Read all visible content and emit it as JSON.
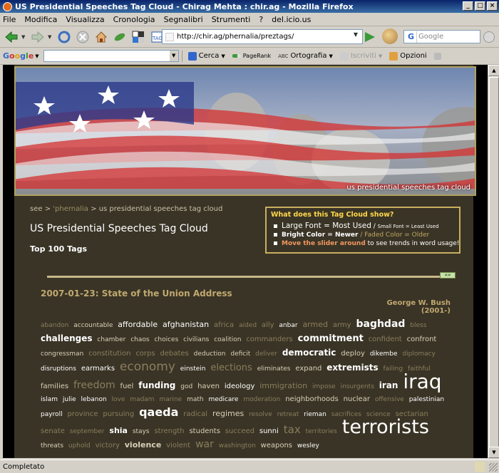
{
  "window": {
    "title": "US Presidential Speeches Tag Cloud - Chirag Mehta : chir.ag - Mozilla Firefox",
    "controls": [
      "_",
      "□",
      "×"
    ]
  },
  "menu": [
    {
      "label": "File"
    },
    {
      "label": "Modifica"
    },
    {
      "label": "Visualizza"
    },
    {
      "label": "Cronologia"
    },
    {
      "label": "Segnalibri"
    },
    {
      "label": "Strumenti"
    },
    {
      "label": "?"
    },
    {
      "label": "del.icio.us"
    }
  ],
  "nav": {
    "url": "http://chir.ag/phernalia/preztags/",
    "search_placeholder": "Google",
    "search_engine_glyph": "G"
  },
  "gtoolbar": {
    "logo": [
      "G",
      "o",
      "o",
      "g",
      "l",
      "e"
    ],
    "cerca": "Cerca",
    "pagerank": "PageRank",
    "ortografia": "Ortografia",
    "iscriviti": "Iscriviti",
    "opzioni": "Opzioni"
  },
  "page": {
    "banner_caption": "us presidential speeches tag cloud",
    "breadcrumb": {
      "see": "see",
      "sep1": " > ",
      "phernalia": "'phernalia",
      "sep2": " > ",
      "current": "us presidential speeches tag cloud"
    },
    "title": "US Presidential Speeches Tag Cloud",
    "subtitle": "Top 100 Tags",
    "info": {
      "heading": "What does this Tag Cloud show?",
      "row1_big": "Large Font = Most Used",
      "row1_sep": " / ",
      "row1_small": "Small Font = Least Used",
      "row2_bright": "Bright Color = Newer",
      "row2_sep": " / ",
      "row2_faded": "Faded Color = Older",
      "row3_link": "Move the slider around",
      "row3_rest": " to see trends in word usage!"
    },
    "slider": {
      "handle_label": "«»"
    },
    "speech_title": "2007-01-23: State of the Union Address",
    "speaker": "George W. Bush (2001-)",
    "tags": [
      {
        "t": "abandon",
        "s": 9,
        "c": "#8a7e5c"
      },
      {
        "t": "accountable",
        "s": 9,
        "c": "#d8d0b8"
      },
      {
        "t": "affordable",
        "s": 11,
        "c": "#ffffff"
      },
      {
        "t": "afghanistan",
        "s": 11,
        "c": "#ffffff"
      },
      {
        "t": "africa",
        "s": 10,
        "c": "#8a7e5c"
      },
      {
        "t": "aided",
        "s": 9,
        "c": "#8a7e5c"
      },
      {
        "t": "ally",
        "s": 10,
        "c": "#8a7e5c"
      },
      {
        "t": "anbar",
        "s": 9,
        "c": "#ffffff"
      },
      {
        "t": "armed",
        "s": 11,
        "c": "#8a7e5c"
      },
      {
        "t": "army",
        "s": 10,
        "c": "#8a7e5c"
      },
      {
        "t": "baghdad",
        "s": 14,
        "c": "#ffffff",
        "b": true
      },
      {
        "t": "bless",
        "s": 9,
        "c": "#8a7e5c"
      },
      {
        "t": "challenges",
        "s": 12,
        "c": "#ffffff",
        "b": true
      },
      {
        "t": "chamber",
        "s": 9,
        "c": "#d8d0b8"
      },
      {
        "t": "chaos",
        "s": 9,
        "c": "#d8d0b8"
      },
      {
        "t": "choices",
        "s": 9,
        "c": "#d8d0b8"
      },
      {
        "t": "civilians",
        "s": 9,
        "c": "#d8d0b8"
      },
      {
        "t": "coalition",
        "s": 9,
        "c": "#d8d0b8"
      },
      {
        "t": "commanders",
        "s": 10,
        "c": "#8a7e5c"
      },
      {
        "t": "commitment",
        "s": 13,
        "c": "#ffffff",
        "b": true
      },
      {
        "t": "confident",
        "s": 10,
        "c": "#8a7e5c"
      },
      {
        "t": "confront",
        "s": 10,
        "c": "#d8d0b8"
      },
      {
        "t": "congressman",
        "s": 9,
        "c": "#d8d0b8"
      },
      {
        "t": "constitution",
        "s": 10,
        "c": "#8a7e5c"
      },
      {
        "t": "corps",
        "s": 10,
        "c": "#8a7e5c"
      },
      {
        "t": "debates",
        "s": 10,
        "c": "#8a7e5c"
      },
      {
        "t": "deduction",
        "s": 9,
        "c": "#d8d0b8"
      },
      {
        "t": "deficit",
        "s": 9,
        "c": "#d8d0b8"
      },
      {
        "t": "deliver",
        "s": 9,
        "c": "#8a7e5c"
      },
      {
        "t": "democratic",
        "s": 12,
        "c": "#ffffff",
        "b": true
      },
      {
        "t": "deploy",
        "s": 10,
        "c": "#d8d0b8"
      },
      {
        "t": "dikembe",
        "s": 9,
        "c": "#ffffff"
      },
      {
        "t": "diplomacy",
        "s": 9,
        "c": "#8a7e5c"
      },
      {
        "t": "disruptions",
        "s": 9,
        "c": "#ffffff"
      },
      {
        "t": "earmarks",
        "s": 10,
        "c": "#ffffff"
      },
      {
        "t": "economy",
        "s": 17,
        "c": "#8a7e5c"
      },
      {
        "t": "einstein",
        "s": 9,
        "c": "#ffffff"
      },
      {
        "t": "elections",
        "s": 13,
        "c": "#8a7e5c"
      },
      {
        "t": "eliminates",
        "s": 9,
        "c": "#d8d0b8"
      },
      {
        "t": "expand",
        "s": 10,
        "c": "#d8d0b8"
      },
      {
        "t": "extremists",
        "s": 12,
        "c": "#ffffff",
        "b": true
      },
      {
        "t": "failing",
        "s": 9,
        "c": "#8a7e5c"
      },
      {
        "t": "faithful",
        "s": 9,
        "c": "#8a7e5c"
      },
      {
        "t": "families",
        "s": 10,
        "c": "#d8d0b8"
      },
      {
        "t": "freedom",
        "s": 14,
        "c": "#8a7e5c"
      },
      {
        "t": "fuel",
        "s": 10,
        "c": "#d8d0b8"
      },
      {
        "t": "funding",
        "s": 12,
        "c": "#ffffff",
        "b": true
      },
      {
        "t": "god",
        "s": 9,
        "c": "#d8d0b8"
      },
      {
        "t": "haven",
        "s": 10,
        "c": "#d8d0b8"
      },
      {
        "t": "ideology",
        "s": 10,
        "c": "#ffffff"
      },
      {
        "t": "immigration",
        "s": 11,
        "c": "#8a7e5c"
      },
      {
        "t": "impose",
        "s": 9,
        "c": "#8a7e5c"
      },
      {
        "t": "insurgents",
        "s": 9,
        "c": "#8a7e5c"
      },
      {
        "t": "iran",
        "s": 12,
        "c": "#ffffff",
        "b": true
      },
      {
        "t": "iraq",
        "s": 28,
        "c": "#ffffff"
      },
      {
        "t": "islam",
        "s": 9,
        "c": "#ffffff"
      },
      {
        "t": "julie",
        "s": 9,
        "c": "#ffffff"
      },
      {
        "t": "lebanon",
        "s": 9,
        "c": "#ffffff"
      },
      {
        "t": "love",
        "s": 9,
        "c": "#8a7e5c"
      },
      {
        "t": "madam",
        "s": 9,
        "c": "#8a7e5c"
      },
      {
        "t": "marine",
        "s": 9,
        "c": "#8a7e5c"
      },
      {
        "t": "math",
        "s": 9,
        "c": "#d8d0b8"
      },
      {
        "t": "medicare",
        "s": 9,
        "c": "#ffffff"
      },
      {
        "t": "moderation",
        "s": 9,
        "c": "#8a7e5c"
      },
      {
        "t": "neighborhoods",
        "s": 10,
        "c": "#d8d0b8"
      },
      {
        "t": "nuclear",
        "s": 10,
        "c": "#d8d0b8"
      },
      {
        "t": "offensive",
        "s": 9,
        "c": "#8a7e5c"
      },
      {
        "t": "palestinian",
        "s": 9,
        "c": "#ffffff"
      },
      {
        "t": "payroll",
        "s": 9,
        "c": "#ffffff"
      },
      {
        "t": "province",
        "s": 10,
        "c": "#8a7e5c"
      },
      {
        "t": "pursuing",
        "s": 10,
        "c": "#8a7e5c"
      },
      {
        "t": "qaeda",
        "s": 16,
        "c": "#ffffff",
        "b": true
      },
      {
        "t": "radical",
        "s": 10,
        "c": "#8a7e5c"
      },
      {
        "t": "regimes",
        "s": 11,
        "c": "#d8d0b8"
      },
      {
        "t": "resolve",
        "s": 9,
        "c": "#8a7e5c"
      },
      {
        "t": "retreat",
        "s": 9,
        "c": "#8a7e5c"
      },
      {
        "t": "rieman",
        "s": 9,
        "c": "#ffffff"
      },
      {
        "t": "sacrifices",
        "s": 9,
        "c": "#8a7e5c"
      },
      {
        "t": "science",
        "s": 9,
        "c": "#8a7e5c"
      },
      {
        "t": "sectarian",
        "s": 10,
        "c": "#8a7e5c"
      },
      {
        "t": "senate",
        "s": 10,
        "c": "#8a7e5c"
      },
      {
        "t": "september",
        "s": 9,
        "c": "#8a7e5c"
      },
      {
        "t": "shia",
        "s": 11,
        "c": "#ffffff",
        "b": true
      },
      {
        "t": "stays",
        "s": 9,
        "c": "#d8d0b8"
      },
      {
        "t": "strength",
        "s": 10,
        "c": "#8a7e5c"
      },
      {
        "t": "students",
        "s": 10,
        "c": "#d8d0b8"
      },
      {
        "t": "succeed",
        "s": 10,
        "c": "#8a7e5c"
      },
      {
        "t": "sunni",
        "s": 10,
        "c": "#ffffff"
      },
      {
        "t": "tax",
        "s": 15,
        "c": "#8a7e5c"
      },
      {
        "t": "territories",
        "s": 9,
        "c": "#8a7e5c"
      },
      {
        "t": "terrorists",
        "s": 27,
        "c": "#ffffff"
      },
      {
        "t": "threats",
        "s": 9,
        "c": "#d8d0b8"
      },
      {
        "t": "uphold",
        "s": 9,
        "c": "#8a7e5c"
      },
      {
        "t": "victory",
        "s": 10,
        "c": "#8a7e5c"
      },
      {
        "t": "violence",
        "s": 11,
        "c": "#d8d0b8",
        "b": true
      },
      {
        "t": "violent",
        "s": 10,
        "c": "#8a7e5c"
      },
      {
        "t": "war",
        "s": 14,
        "c": "#8a7e5c"
      },
      {
        "t": "washington",
        "s": 9,
        "c": "#8a7e5c"
      },
      {
        "t": "weapons",
        "s": 10,
        "c": "#d8d0b8"
      },
      {
        "t": "wesley",
        "s": 9,
        "c": "#ffffff"
      }
    ]
  },
  "status": {
    "text": "Completato"
  }
}
